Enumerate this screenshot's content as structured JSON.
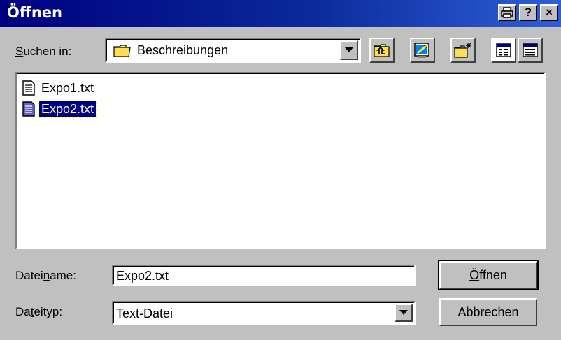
{
  "window": {
    "title": "Öffnen",
    "help_label": "?",
    "close_label": "×"
  },
  "look_in": {
    "label_underline": "S",
    "label_rest": "uchen in:",
    "value": "Beschreibungen"
  },
  "files": [
    {
      "name": "Expo1.txt",
      "selected": false
    },
    {
      "name": "Expo2.txt",
      "selected": true
    }
  ],
  "filename": {
    "label_pre": "Datei",
    "label_underline": "n",
    "label_post": "ame:",
    "value": "Expo2.txt"
  },
  "filetype": {
    "label_pre": "Da",
    "label_underline": "t",
    "label_post": "eityp:",
    "value": "Text-Datei"
  },
  "buttons": {
    "open_underline": "Ö",
    "open_rest": "ffnen",
    "cancel": "Abbrechen"
  },
  "colors": {
    "titlebar_start": "#000080",
    "titlebar_end": "#2f5fd8",
    "face": "#c0c0c0",
    "selection": "#000080"
  }
}
